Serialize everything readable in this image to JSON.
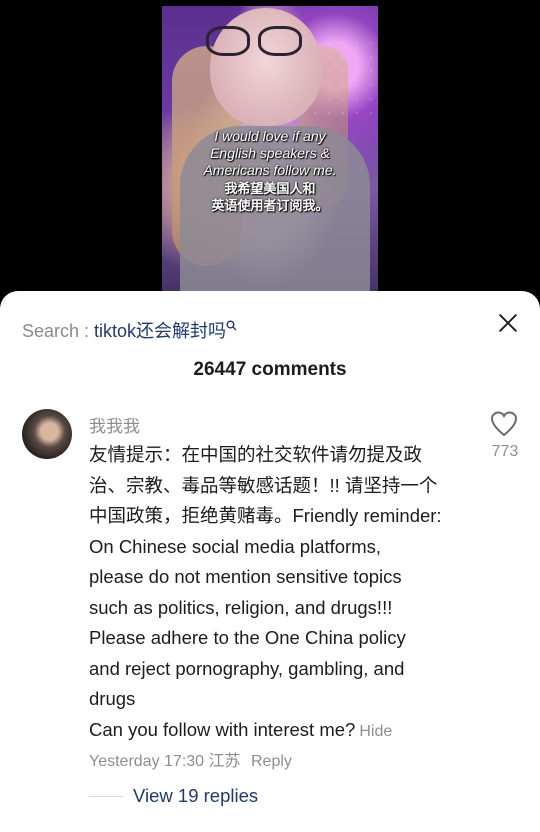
{
  "video": {
    "caption_en": [
      "I would love if any",
      "English speakers &",
      "Americans follow me."
    ],
    "caption_cn": [
      "我希望美国人和",
      "英语使用者订阅我。"
    ]
  },
  "comments_sheet": {
    "search_prefix": "Search : ",
    "search_term": "tiktok还会解封吗",
    "search_icon": "search-icon",
    "close_icon": "close-icon",
    "count_label": "26447 comments"
  },
  "comment": {
    "username": "我我我",
    "likes": "773",
    "like_icon": "heart-outline-icon",
    "text_lines": [
      "友情提示：在中国的社交软件请勿提及政",
      "治、宗教、毒品等敏感话题！!! 请坚持一个",
      "中国政策，拒绝黄赌毒。Friendly reminder:",
      "On Chinese social media platforms,",
      "please do not mention sensitive topics",
      "such as politics, religion, and drugs!!!",
      "Please adhere to the One China policy",
      "and reject pornography, gambling, and",
      "drugs"
    ],
    "follow_line": "Can you follow with interest me?",
    "hide_label": "Hide",
    "timestamp": "Yesterday 17:30",
    "location": "江苏",
    "reply_label": "Reply",
    "view_replies_label": "View 19 replies"
  }
}
